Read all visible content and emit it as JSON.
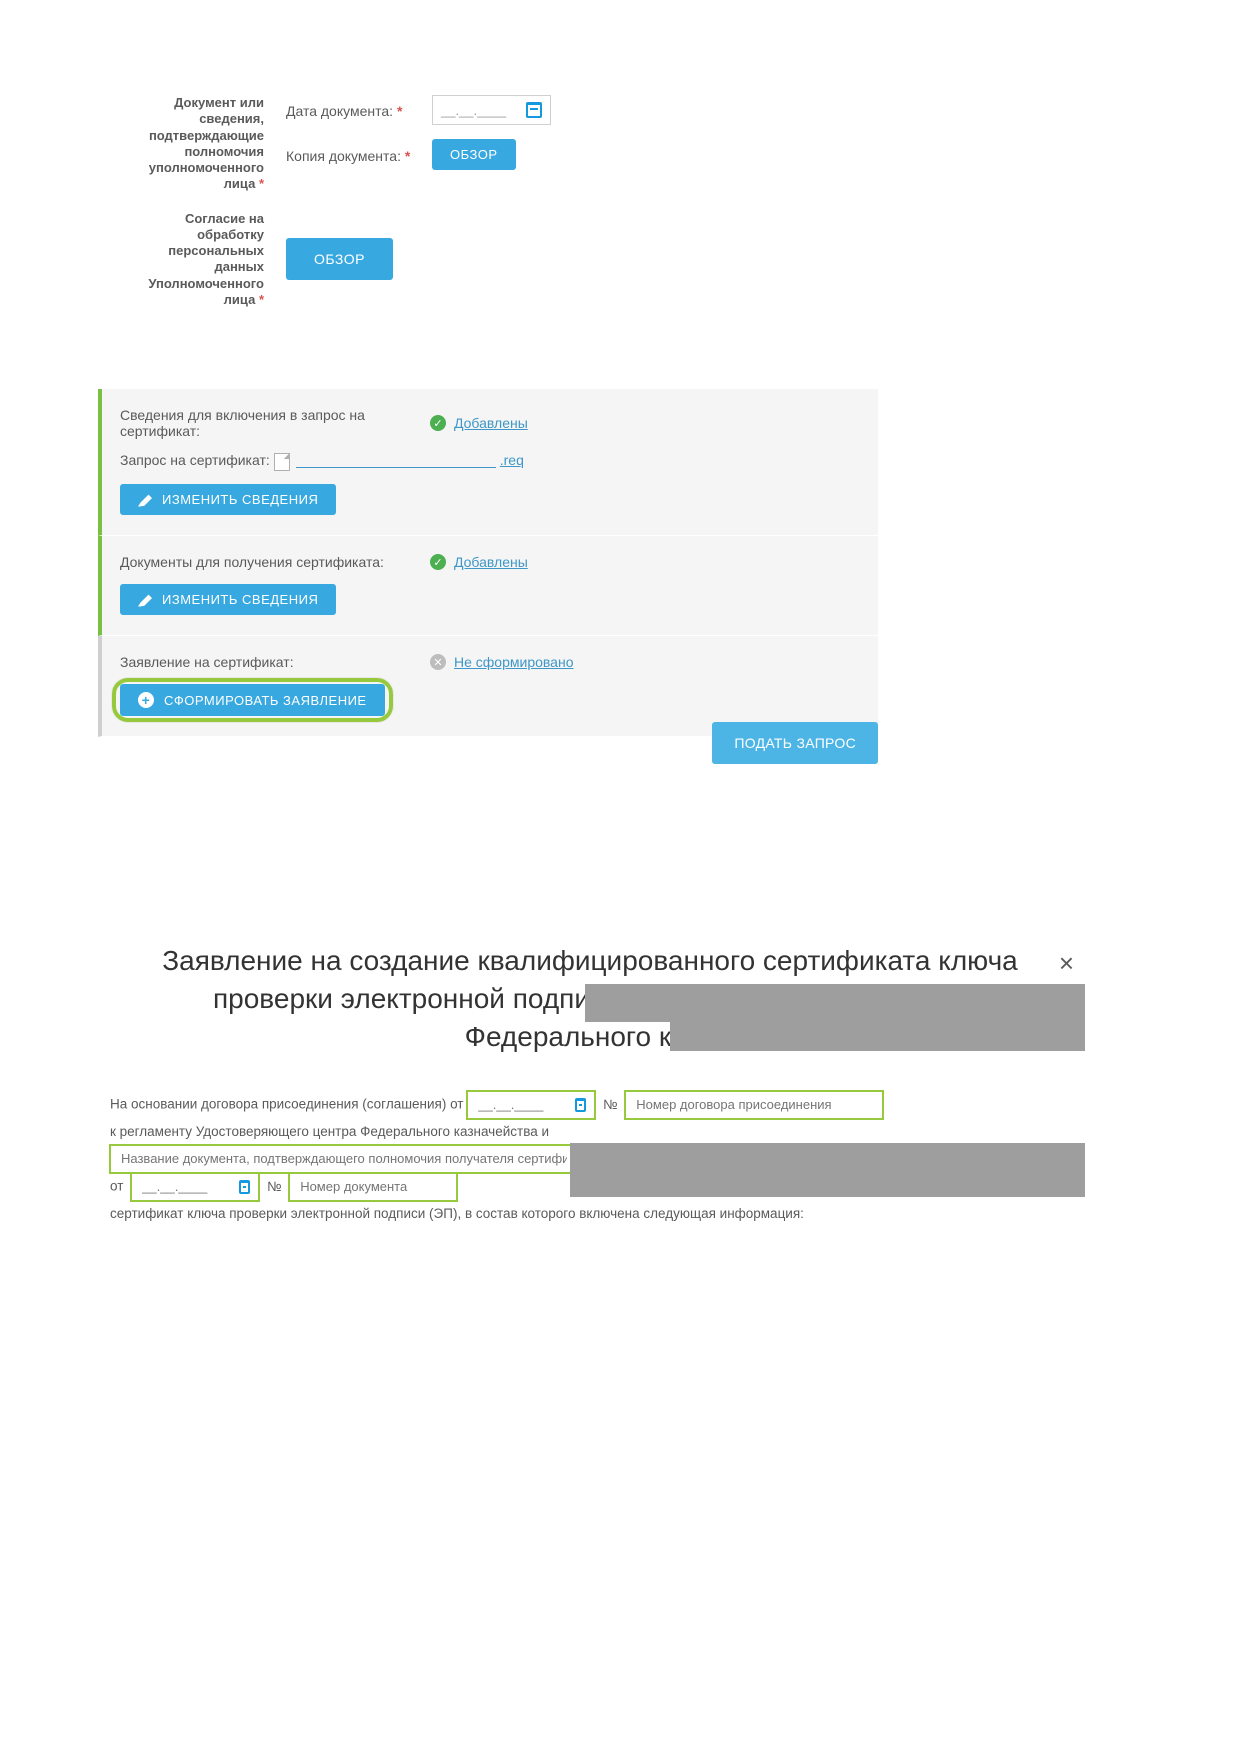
{
  "section1": {
    "doc_group_label": "Документ или сведения, подтверждающие полномочия уполномоченного лица",
    "date_label": "Дата документа:",
    "date_placeholder": "__.__.____",
    "copy_label": "Копия документа:",
    "browse_label": "ОБЗОР",
    "consent_label": "Согласие на обработку персональных данных Уполномоченного лица",
    "consent_browse_label": "ОБЗОР",
    "required_marker": "*"
  },
  "panel": {
    "row1": {
      "label": "Сведения для включения в запрос на сертификат:",
      "status_text": "Добавлены",
      "status_ok": true,
      "request_label": "Запрос на сертификат:",
      "request_ext": ".req",
      "edit_btn": "ИЗМЕНИТЬ СВЕДЕНИЯ"
    },
    "row2": {
      "label": "Документы для получения сертификата:",
      "status_text": "Добавлены",
      "status_ok": true,
      "edit_btn": "ИЗМЕНИТЬ СВЕДЕНИЯ"
    },
    "row3": {
      "label": "Заявление на сертификат:",
      "status_text": "Не сформировано",
      "status_ok": false,
      "create_btn": "СФОРМИРОВАТЬ ЗАЯВЛЕНИЕ"
    },
    "submit_btn": "ПОДАТЬ ЗАПРОС"
  },
  "modal": {
    "title_visible": "Заявление на создание квалифицированного сертификата ключа проверки электронной подпис                                   центре Федерального казн",
    "line1_prefix": "На основании договора присоединения (соглашения) от",
    "date_placeholder": "__.__.____",
    "number_label": "№",
    "agreement_number_placeholder": "Номер договора присоединения",
    "line2": "к регламенту Удостоверяющего центра Федерального казначейства и",
    "doc_name_placeholder": "Название документа, подтверждающего полномочия получателя сертификата",
    "line3_prefix": "от",
    "doc_number_placeholder": "Номер документа",
    "line4": "сертификат ключа проверки электронной подписи (ЭП), в состав которого включена следующая информация:",
    "close": "×"
  }
}
